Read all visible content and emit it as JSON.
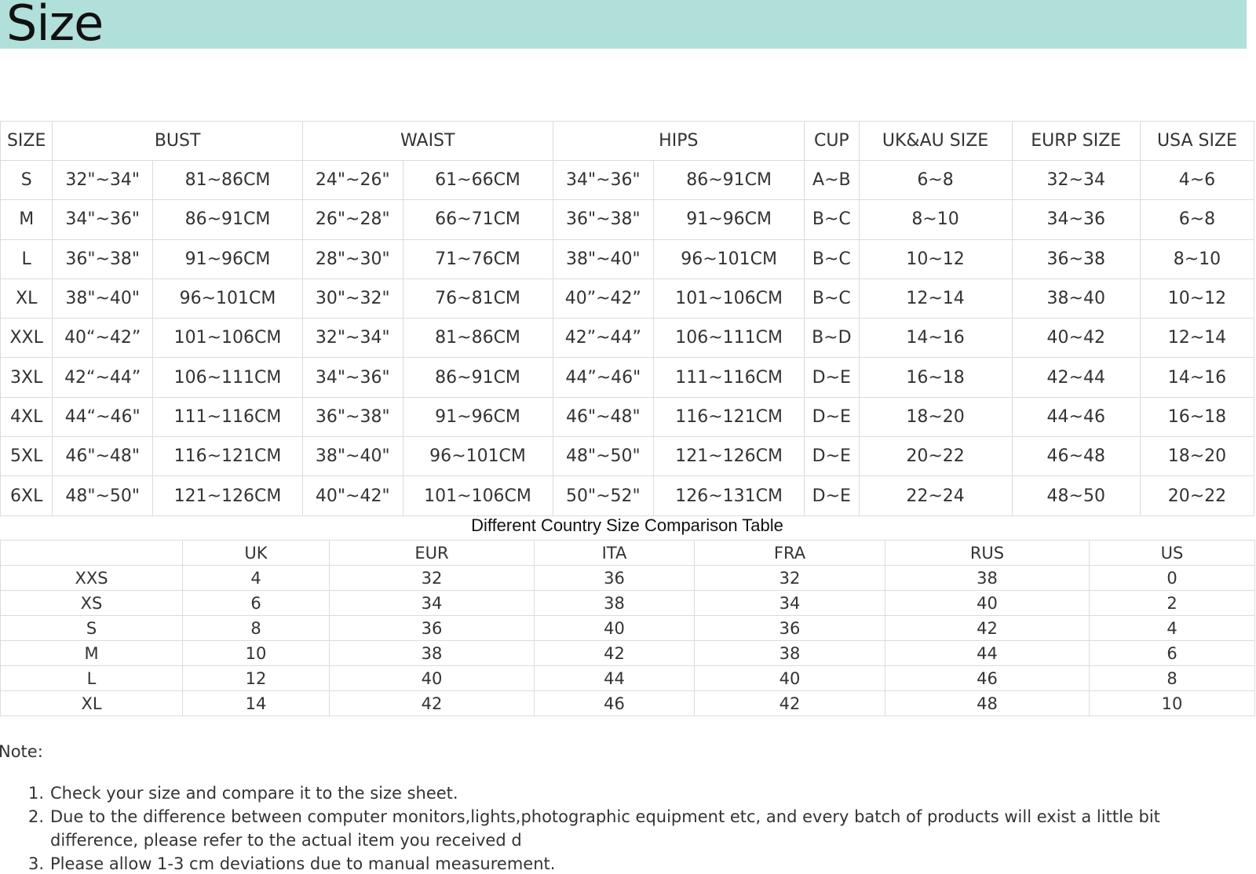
{
  "banner": {
    "title": "Size"
  },
  "size_table": {
    "headers": {
      "size": "SIZE",
      "bust": "BUST",
      "waist": "WAIST",
      "hips": "HIPS",
      "cup": "CUP",
      "ukau": "UK&AU SIZE",
      "eurp": "EURP SIZE",
      "usa": "USA SIZE"
    },
    "rows": [
      [
        "S",
        "32\"~34\"",
        "81~86CM",
        "24\"~26\"",
        "61~66CM",
        "34\"~36\"",
        "86~91CM",
        "A~B",
        "6~8",
        "32~34",
        "4~6"
      ],
      [
        "M",
        "34\"~36\"",
        "86~91CM",
        "26\"~28\"",
        "66~71CM",
        "36\"~38\"",
        "91~96CM",
        "B~C",
        "8~10",
        "34~36",
        "6~8"
      ],
      [
        "L",
        "36\"~38\"",
        "91~96CM",
        "28\"~30\"",
        "71~76CM",
        "38\"~40\"",
        "96~101CM",
        "B~C",
        "10~12",
        "36~38",
        "8~10"
      ],
      [
        "XL",
        "38\"~40\"",
        "96~101CM",
        "30\"~32\"",
        "76~81CM",
        "40”~42”",
        "101~106CM",
        "B~C",
        "12~14",
        "38~40",
        "10~12"
      ],
      [
        "XXL",
        "40“~42”",
        "101~106CM",
        "32\"~34\"",
        "81~86CM",
        "42”~44”",
        "106~111CM",
        "B~D",
        "14~16",
        "40~42",
        "12~14"
      ],
      [
        "3XL",
        "42“~44”",
        "106~111CM",
        "34\"~36\"",
        "86~91CM",
        "44”~46\"",
        "111~116CM",
        "D~E",
        "16~18",
        "42~44",
        "14~16"
      ],
      [
        "4XL",
        "44“~46\"",
        "111~116CM",
        "36\"~38\"",
        "91~96CM",
        "46\"~48\"",
        "116~121CM",
        "D~E",
        "18~20",
        "44~46",
        "16~18"
      ],
      [
        "5XL",
        "46\"~48\"",
        "116~121CM",
        "38\"~40\"",
        "96~101CM",
        "48\"~50\"",
        "121~126CM",
        "D~E",
        "20~22",
        "46~48",
        "18~20"
      ],
      [
        "6XL",
        "48\"~50\"",
        "121~126CM",
        "40\"~42\"",
        "101~106CM",
        "50\"~52\"",
        "126~131CM",
        "D~E",
        "22~24",
        "48~50",
        "20~22"
      ]
    ]
  },
  "comparison": {
    "caption": "Different Country Size Comparison Table",
    "headers": [
      "",
      "UK",
      "EUR",
      "ITA",
      "FRA",
      "RUS",
      "US"
    ],
    "rows": [
      [
        "XXS",
        "4",
        "32",
        "36",
        "32",
        "38",
        "0"
      ],
      [
        "XS",
        "6",
        "34",
        "38",
        "34",
        "40",
        "2"
      ],
      [
        "S",
        "8",
        "36",
        "40",
        "36",
        "42",
        "4"
      ],
      [
        "M",
        "10",
        "38",
        "42",
        "38",
        "44",
        "6"
      ],
      [
        "L",
        "12",
        "40",
        "44",
        "40",
        "46",
        "8"
      ],
      [
        "XL",
        "14",
        "42",
        "46",
        "42",
        "48",
        "10"
      ]
    ]
  },
  "notes": {
    "label": "Note:",
    "items": [
      {
        "num": "1.",
        "text": "Check your size and compare it to the size sheet."
      },
      {
        "num": "2.",
        "text": "Due to the difference between computer monitors,lights,photographic equipment etc, and every batch of products will exist a little bit difference, please refer to the actual item you received d"
      },
      {
        "num": "3.",
        "text": "Please allow 1-3 cm deviations due to manual measurement."
      }
    ]
  }
}
